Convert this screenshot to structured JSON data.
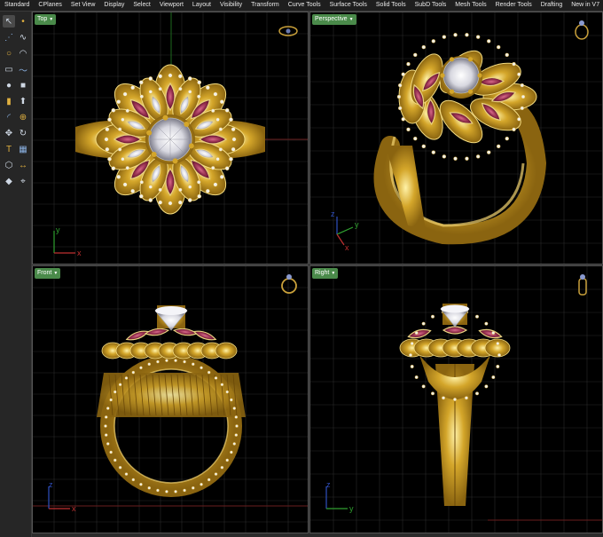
{
  "tabs": [
    {
      "label": "Standard",
      "active": false
    },
    {
      "label": "CPlanes",
      "active": false
    },
    {
      "label": "Set View",
      "active": false
    },
    {
      "label": "Display",
      "active": false
    },
    {
      "label": "Select",
      "active": false
    },
    {
      "label": "Viewport",
      "active": false
    },
    {
      "label": "Layout",
      "active": false
    },
    {
      "label": "Visibility",
      "active": false
    },
    {
      "label": "Transform",
      "active": false
    },
    {
      "label": "Curve Tools",
      "active": false
    },
    {
      "label": "Surface Tools",
      "active": false
    },
    {
      "label": "Solid Tools",
      "active": false
    },
    {
      "label": "SubD Tools",
      "active": false
    },
    {
      "label": "Mesh Tools",
      "active": false
    },
    {
      "label": "Render Tools",
      "active": false
    },
    {
      "label": "Drafting",
      "active": false
    },
    {
      "label": "New in V7",
      "active": false
    }
  ],
  "viewports": {
    "top": {
      "label": "Top"
    },
    "perspective": {
      "label": "Perspective"
    },
    "front": {
      "label": "Front"
    },
    "right": {
      "label": "Right"
    }
  },
  "axes": {
    "x": "x",
    "y": "y",
    "z": "z"
  },
  "colors": {
    "gold": "#d4a62a",
    "gold_dark": "#8a6410",
    "ruby": "#8e2a4a",
    "diamond": "#e8e8ee",
    "grid": "#2a2a2a",
    "axis_x": "#c03030",
    "axis_y": "#30a030",
    "axis_z": "#3050c0",
    "label_bg": "#4a8a4a"
  },
  "icons": [
    "select-arrow-icon",
    "point-icon",
    "line-icon",
    "polyline-icon",
    "circle-icon",
    "arc-icon",
    "rectangle-icon",
    "curve-icon",
    "sphere-icon",
    "box-icon",
    "cylinder-icon",
    "extrude-icon",
    "fillet-icon",
    "boolean-icon",
    "move-icon",
    "rotate-icon",
    "text-icon",
    "array-icon",
    "mesh-icon",
    "dimension-icon",
    "render-icon",
    "analyze-icon"
  ]
}
